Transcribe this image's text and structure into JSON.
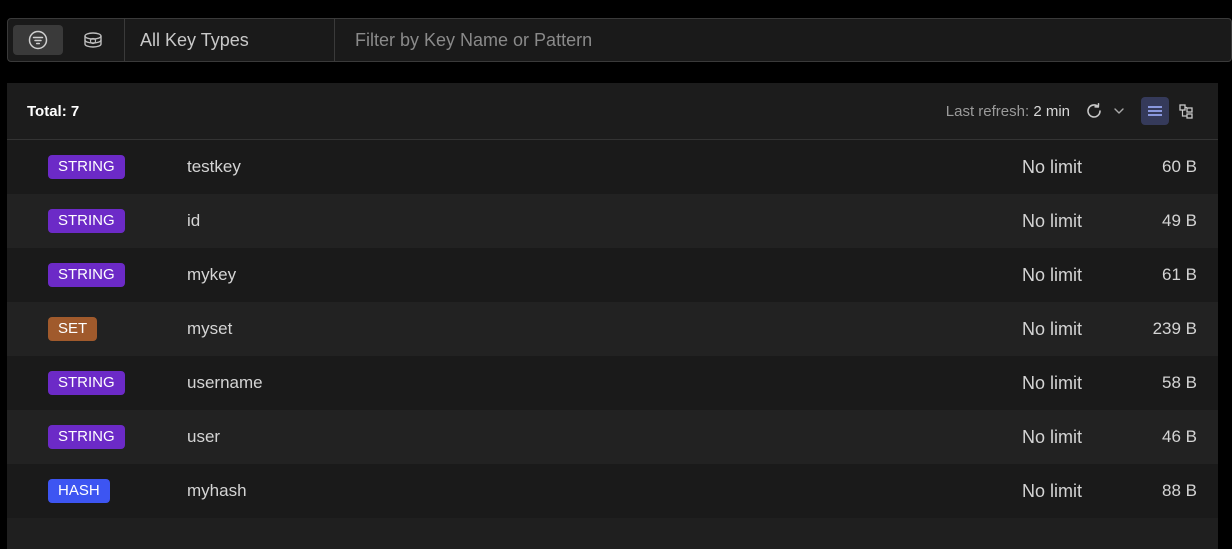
{
  "toolbar": {
    "modes": [
      {
        "icon": "filter-icon",
        "active": true
      },
      {
        "icon": "search-index-icon",
        "active": false
      }
    ],
    "type_select": "All Key Types",
    "filter_placeholder": "Filter by Key Name or Pattern"
  },
  "header": {
    "total_label": "Total: 7",
    "refresh_label": "Last refresh:",
    "refresh_value": "2 min"
  },
  "colors": {
    "string": "#6c2ac7",
    "set": "#a05a2c",
    "hash": "#3d55f2"
  },
  "keys": [
    {
      "type": "STRING",
      "color": "#6c2ac7",
      "name": "testkey",
      "ttl": "No limit",
      "size": "60 B"
    },
    {
      "type": "STRING",
      "color": "#6c2ac7",
      "name": "id",
      "ttl": "No limit",
      "size": "49 B"
    },
    {
      "type": "STRING",
      "color": "#6c2ac7",
      "name": "mykey",
      "ttl": "No limit",
      "size": "61 B"
    },
    {
      "type": "SET",
      "color": "#a05a2c",
      "name": "myset",
      "ttl": "No limit",
      "size": "239 B"
    },
    {
      "type": "STRING",
      "color": "#6c2ac7",
      "name": "username",
      "ttl": "No limit",
      "size": "58 B"
    },
    {
      "type": "STRING",
      "color": "#6c2ac7",
      "name": "user",
      "ttl": "No limit",
      "size": "46 B"
    },
    {
      "type": "HASH",
      "color": "#3d55f2",
      "name": "myhash",
      "ttl": "No limit",
      "size": "88 B"
    }
  ]
}
